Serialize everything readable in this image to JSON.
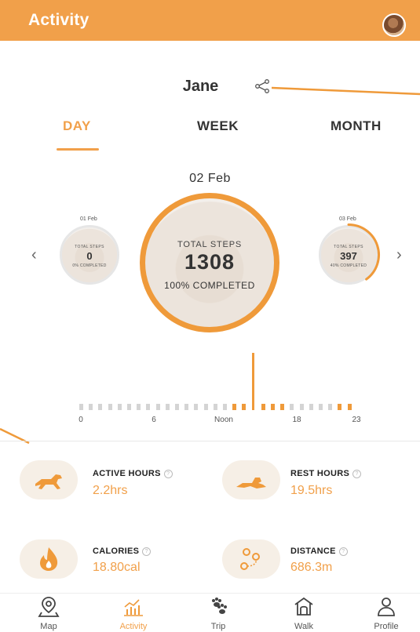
{
  "header": {
    "title": "Activity",
    "avatar_icon": "dog-avatar"
  },
  "user": {
    "name": "Jane"
  },
  "tabs": [
    {
      "label": "DAY",
      "active": true
    },
    {
      "label": "WEEK",
      "active": false
    },
    {
      "label": "MONTH",
      "active": false
    }
  ],
  "current_day": {
    "date": "02 Feb",
    "steps_label": "TOTAL STEPS",
    "steps": "1308",
    "completed": "100% COMPLETED"
  },
  "previous_day": {
    "date": "01 Feb",
    "steps_label": "TOTAL STEPS",
    "steps": "0",
    "completed": "0% COMPLETED"
  },
  "next_day": {
    "date": "03 Feb",
    "steps_label": "TOTAL STEPS",
    "steps": "397",
    "completed": "40% COMPLETED",
    "progress": 0.4
  },
  "hourly": {
    "tick_labels": [
      "0",
      "6",
      "Noon",
      "18",
      "23"
    ],
    "activity_levels": [
      0.11,
      0.11,
      0.11,
      0.11,
      0.11,
      0.11,
      0.11,
      0.11,
      0.11,
      0.11,
      0.11,
      0.11,
      0.11,
      0.11,
      0.11,
      0.11,
      0.11,
      0.11,
      1.0,
      0.11,
      0.11,
      0.11,
      0.11,
      0.11,
      0.11,
      0.11,
      0.11,
      0.11,
      0.11
    ],
    "highlighted_hours": [
      16,
      17,
      18,
      19,
      20,
      21,
      27,
      28
    ],
    "colors": {
      "inactive": "#d4d4d4",
      "active": "#ef9a3a"
    }
  },
  "stats": [
    {
      "title": "ACTIVE HOURS",
      "value": "2.2hrs",
      "icon": "running-dog-icon"
    },
    {
      "title": "REST HOURS",
      "value": "19.5hrs",
      "icon": "resting-dog-icon"
    },
    {
      "title": "CALORIES",
      "value": "18.80cal",
      "icon": "flame-icon"
    },
    {
      "title": "DISTANCE",
      "value": "686.3m",
      "icon": "route-icon"
    }
  ],
  "nav": [
    {
      "label": "Map",
      "icon": "map-pin-icon",
      "active": false
    },
    {
      "label": "Activity",
      "icon": "chart-icon",
      "active": true
    },
    {
      "label": "Trip",
      "icon": "paw-icon",
      "active": false
    },
    {
      "label": "Walk",
      "icon": "dog-house-icon",
      "active": false
    },
    {
      "label": "Profile",
      "icon": "person-icon",
      "active": false
    }
  ],
  "colors": {
    "accent": "#f1a04a",
    "ring": "#ef9a3a",
    "text": "#333333"
  }
}
